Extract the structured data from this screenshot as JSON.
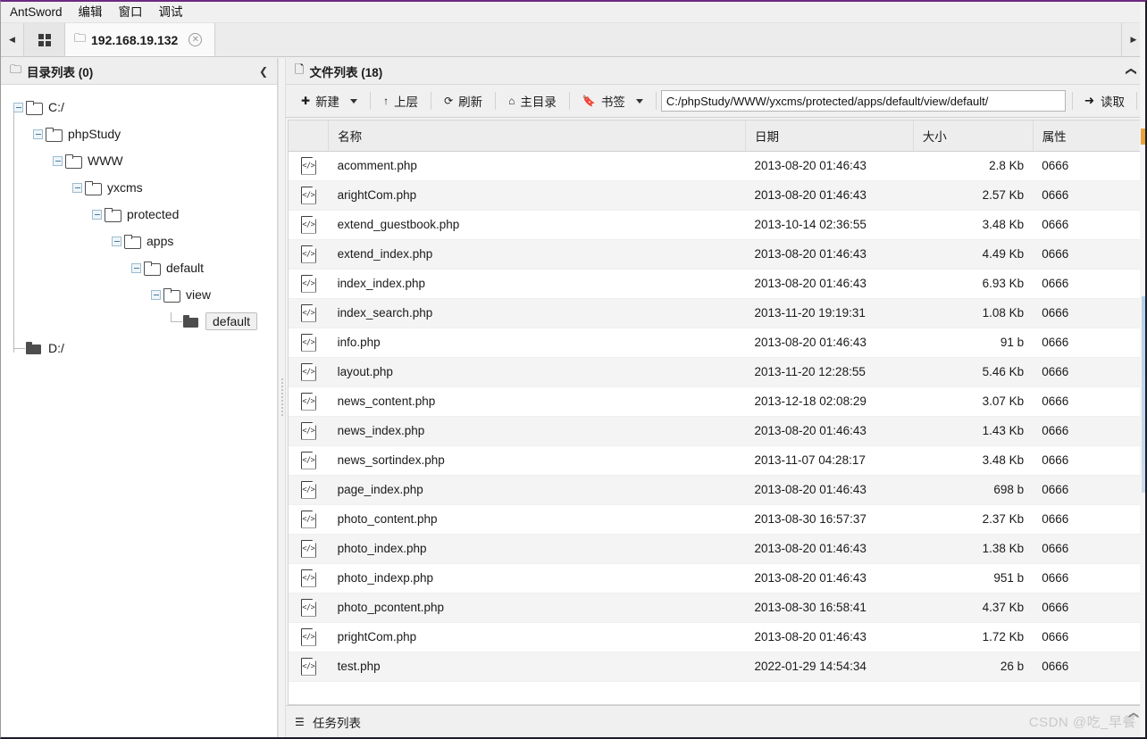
{
  "app": {
    "title": "AntSword",
    "accent_purple": "#6b2a80"
  },
  "menubar": {
    "items": [
      {
        "label": "AntSword",
        "name": "menu-antsword"
      },
      {
        "label": "编辑",
        "name": "menu-edit"
      },
      {
        "label": "窗口",
        "name": "menu-window"
      },
      {
        "label": "调试",
        "name": "menu-debug"
      }
    ]
  },
  "tabbar": {
    "scroll_left_icon": "◀",
    "scroll_right_icon": "▶",
    "grid_icon": "grid-icon",
    "tabs": [
      {
        "label": "192.168.19.132",
        "folder_icon": "🗀",
        "close_icon": "✕"
      }
    ]
  },
  "left_panel": {
    "header_icon": "🗀",
    "header_title": "目录列表 (0)",
    "collapse_icon": "❮",
    "tree": [
      {
        "label": "C:/",
        "depth": 0,
        "state": "open",
        "selected": false
      },
      {
        "label": "phpStudy",
        "depth": 1,
        "state": "open",
        "selected": false
      },
      {
        "label": "WWW",
        "depth": 2,
        "state": "open",
        "selected": false
      },
      {
        "label": "yxcms",
        "depth": 3,
        "state": "open",
        "selected": false
      },
      {
        "label": "protected",
        "depth": 4,
        "state": "open",
        "selected": false
      },
      {
        "label": "apps",
        "depth": 5,
        "state": "open",
        "selected": false
      },
      {
        "label": "default",
        "depth": 6,
        "state": "open",
        "selected": false
      },
      {
        "label": "view",
        "depth": 7,
        "state": "open",
        "selected": false
      },
      {
        "label": "default",
        "depth": 8,
        "state": "leaf",
        "selected": true
      },
      {
        "label": "D:/",
        "depth": 0,
        "state": "closed",
        "selected": false
      }
    ]
  },
  "right_panel": {
    "header_icon": "🗋",
    "header_title": "文件列表 (18)",
    "collapse_icon": "❮",
    "toolbar": {
      "new_label": "新建",
      "new_icon": "✚",
      "up_label": "上层",
      "up_icon": "↑",
      "refresh_label": "刷新",
      "refresh_icon": "⟳",
      "home_label": "主目录",
      "home_icon": "⌂",
      "bookmark_label": "书签",
      "bookmark_icon": "🔖",
      "path_value": "C:/phpStudy/WWW/yxcms/protected/apps/default/view/default/",
      "path_placeholder": "",
      "read_label": "读取",
      "read_icon": "➜"
    },
    "table": {
      "columns": [
        "",
        "名称",
        "日期",
        "大小",
        "属性"
      ],
      "rows": [
        {
          "icon": "code-file-icon",
          "name": "acomment.php",
          "date": "2013-08-20 01:46:43",
          "size": "2.8 Kb",
          "attr": "0666"
        },
        {
          "icon": "code-file-icon",
          "name": "arightCom.php",
          "date": "2013-08-20 01:46:43",
          "size": "2.57 Kb",
          "attr": "0666"
        },
        {
          "icon": "code-file-icon",
          "name": "extend_guestbook.php",
          "date": "2013-10-14 02:36:55",
          "size": "3.48 Kb",
          "attr": "0666"
        },
        {
          "icon": "code-file-icon",
          "name": "extend_index.php",
          "date": "2013-08-20 01:46:43",
          "size": "4.49 Kb",
          "attr": "0666"
        },
        {
          "icon": "code-file-icon",
          "name": "index_index.php",
          "date": "2013-08-20 01:46:43",
          "size": "6.93 Kb",
          "attr": "0666"
        },
        {
          "icon": "code-file-icon",
          "name": "index_search.php",
          "date": "2013-11-20 19:19:31",
          "size": "1.08 Kb",
          "attr": "0666"
        },
        {
          "icon": "code-file-icon",
          "name": "info.php",
          "date": "2013-08-20 01:46:43",
          "size": "91 b",
          "attr": "0666"
        },
        {
          "icon": "code-file-icon",
          "name": "layout.php",
          "date": "2013-11-20 12:28:55",
          "size": "5.46 Kb",
          "attr": "0666"
        },
        {
          "icon": "code-file-icon",
          "name": "news_content.php",
          "date": "2013-12-18 02:08:29",
          "size": "3.07 Kb",
          "attr": "0666"
        },
        {
          "icon": "code-file-icon",
          "name": "news_index.php",
          "date": "2013-08-20 01:46:43",
          "size": "1.43 Kb",
          "attr": "0666"
        },
        {
          "icon": "code-file-icon",
          "name": "news_sortindex.php",
          "date": "2013-11-07 04:28:17",
          "size": "3.48 Kb",
          "attr": "0666"
        },
        {
          "icon": "code-file-icon",
          "name": "page_index.php",
          "date": "2013-08-20 01:46:43",
          "size": "698 b",
          "attr": "0666"
        },
        {
          "icon": "code-file-icon",
          "name": "photo_content.php",
          "date": "2013-08-30 16:57:37",
          "size": "2.37 Kb",
          "attr": "0666"
        },
        {
          "icon": "code-file-icon",
          "name": "photo_index.php",
          "date": "2013-08-20 01:46:43",
          "size": "1.38 Kb",
          "attr": "0666"
        },
        {
          "icon": "code-file-icon",
          "name": "photo_indexp.php",
          "date": "2013-08-20 01:46:43",
          "size": "951 b",
          "attr": "0666"
        },
        {
          "icon": "code-file-icon",
          "name": "photo_pcontent.php",
          "date": "2013-08-30 16:58:41",
          "size": "4.37 Kb",
          "attr": "0666"
        },
        {
          "icon": "code-file-icon",
          "name": "prightCom.php",
          "date": "2013-08-20 01:46:43",
          "size": "1.72 Kb",
          "attr": "0666"
        },
        {
          "icon": "code-file-icon",
          "name": "test.php",
          "date": "2022-01-29 14:54:34",
          "size": "26 b",
          "attr": "0666"
        }
      ]
    }
  },
  "statusbar": {
    "icon": "list-icon",
    "label": "任务列表",
    "watermark": "CSDN @吃_早餐",
    "expand_icon": "❮"
  }
}
